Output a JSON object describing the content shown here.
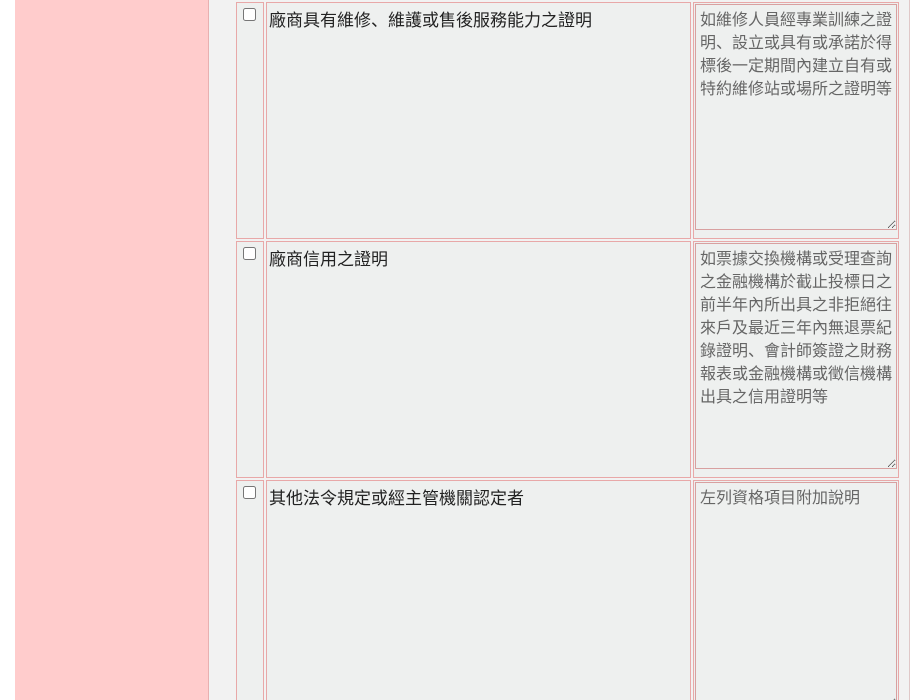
{
  "colors": {
    "left_panel_bg": "#ffcccc",
    "row_border": "#e8a8a8",
    "cell_bg": "#eef0ef"
  },
  "qualification_rows": [
    {
      "checked": false,
      "label": "廠商具有維修、維護或售後服務能力之證明",
      "note_placeholder": "如維修人員經專業訓練之證明、設立或具有或承諾於得標後一定期間內建立自有或特約維修站或場所之證明等"
    },
    {
      "checked": false,
      "label": "廠商信用之證明",
      "note_placeholder": "如票據交換機構或受理查詢之金融機構於截止投標日之前半年內所出具之非拒絕往來戶及最近三年內無退票紀錄證明、會計師簽證之財務報表或金融機構或徵信機構出具之信用證明等"
    },
    {
      "checked": false,
      "label": "其他法令規定或經主管機關認定者",
      "note_placeholder": "左列資格項目附加說明"
    }
  ]
}
